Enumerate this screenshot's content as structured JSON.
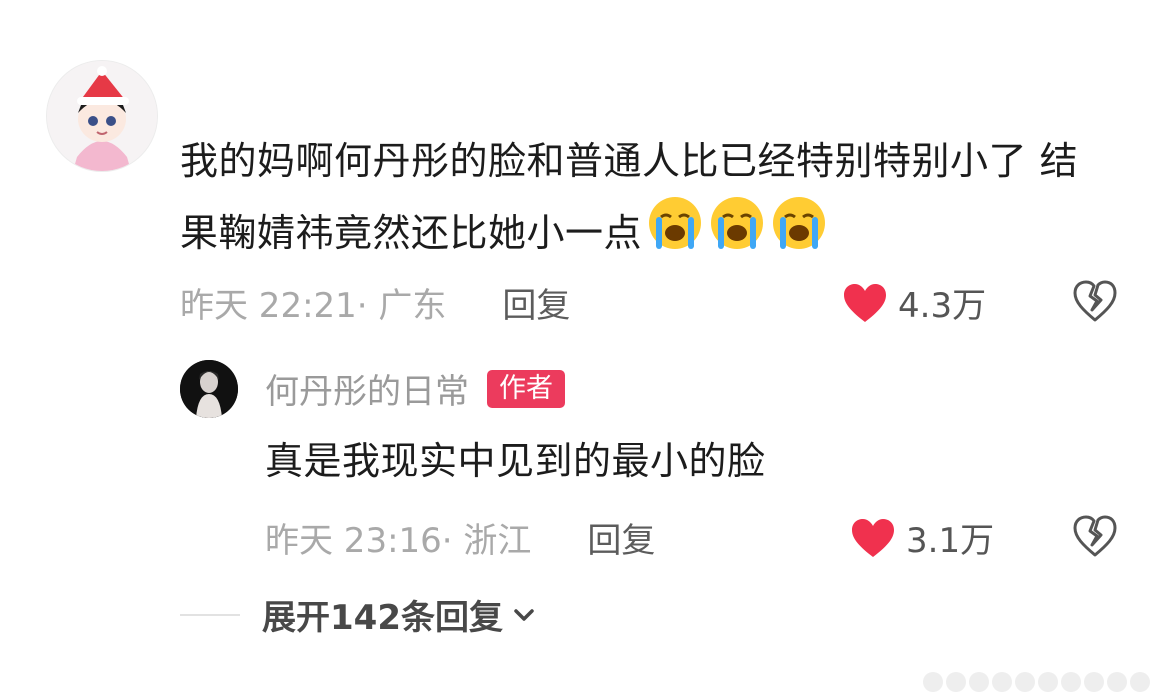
{
  "comment": {
    "text": "我的妈啊何丹彤的脸和普通人比已经特别特别小了 结果鞠婧祎竟然还比她小一点",
    "emoji": "loudly-crying-face-icon",
    "emoji_count": 3,
    "meta": "昨天 22:21· 广东",
    "reply_label": "回复",
    "likes": "4.3万"
  },
  "reply": {
    "username": "何丹彤的日常",
    "badge": "作者",
    "text": "真是我现实中见到的最小的脸",
    "meta": "昨天 23:16· 浙江",
    "reply_label": "回复",
    "likes": "3.1万"
  },
  "expand_label": "展开142条回复",
  "colors": {
    "heart": "#f0314e",
    "badge": "#ec3b5d",
    "text": "#1c1c1c",
    "meta": "#a9a9a9"
  }
}
